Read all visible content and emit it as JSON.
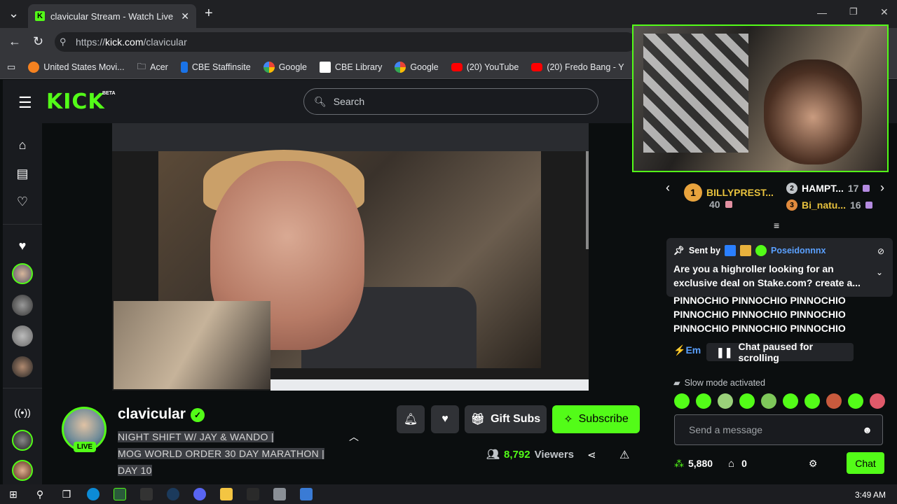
{
  "browser": {
    "tab_title": "clavicular Stream - Watch Live on",
    "url_prefix": "https://",
    "url_domain": "kick.com",
    "url_path": "/clavicular",
    "bookmarks": [
      {
        "label": "United States Movi...",
        "color": "#f58220"
      },
      {
        "label": "Acer",
        "color": "#a0a0a0"
      },
      {
        "label": "CBE Staffinsite",
        "color": "#1a73e8"
      },
      {
        "label": "Google",
        "color": "#4285f4"
      },
      {
        "label": "CBE Library",
        "color": "#ffffff"
      },
      {
        "label": "Google",
        "color": "#4285f4"
      },
      {
        "label": "(20) YouTube",
        "color": "#ff0000"
      },
      {
        "label": "(20) Fredo Bang - Y",
        "color": "#ff0000"
      }
    ]
  },
  "kick": {
    "logo": "KICK",
    "beta": "BETA",
    "search_placeholder": "Search",
    "accent": "#53fc18"
  },
  "channel": {
    "name": "clavicular",
    "live_label": "LIVE",
    "title_lines": [
      "NIGHT SHIFT W/ JAY & WANDO |",
      "MOG WORLD ORDER 30 DAY MARATHON |",
      "DAY 10"
    ],
    "gift_label": "Gift Subs",
    "subscribe_label": "Subscribe",
    "viewers_count": "8,792",
    "viewers_label": "Viewers"
  },
  "leaderboard": {
    "first": {
      "name": "BILLYPREST...",
      "count": "40"
    },
    "second": {
      "name": "HAMPT...",
      "count": "17"
    },
    "third": {
      "name": "Bi_natu...",
      "count": "16"
    }
  },
  "pinned": {
    "sent_by": "Sent by",
    "user": "Poseidonnnx",
    "message": "Are you a highroller looking for an exclusive deal on Stake.com? create a..."
  },
  "chat": {
    "lines": [
      "PINNOCHIO PINNOCHIO PINNOCHIO",
      "PINNOCHIO PINNOCHIO PINNOCHIO",
      "PINNOCHIO PINNOCHIO PINNOCHIO"
    ],
    "partial_user": "Em",
    "paused_label": "Chat paused for scrolling",
    "slow_mode": "Slow mode activated",
    "input_placeholder": "Send a message",
    "points": "5,880",
    "gift_count": "0",
    "chat_button": "Chat"
  },
  "os": {
    "time": "3:49 AM"
  }
}
